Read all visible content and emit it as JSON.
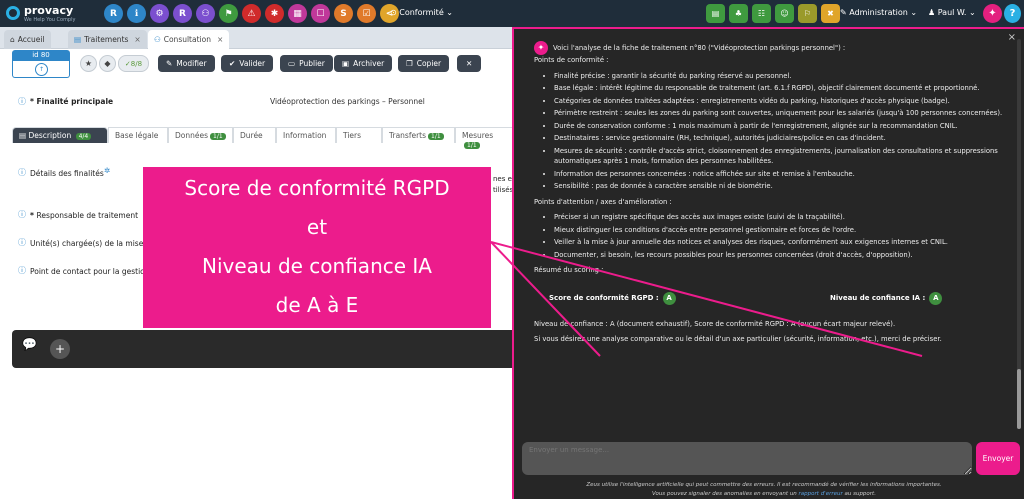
{
  "app": {
    "logo_name": "provacy",
    "logo_tagline": "We Help You Comply",
    "conformite_menu": "Conformité",
    "admin_menu": "Administration",
    "user_menu": "Paul W.",
    "nav_icons": [
      {
        "icon": "R",
        "color": "#2e86c8"
      },
      {
        "icon": "ℹ",
        "color": "#2e86c8"
      },
      {
        "icon": "⚙",
        "color": "#7b4fcf"
      },
      {
        "icon": "R",
        "color": "#7b4fcf"
      },
      {
        "icon": "⚇",
        "color": "#7b4fcf"
      },
      {
        "icon": "⚑",
        "color": "#3f9a3f"
      },
      {
        "icon": "⚠",
        "color": "#d02b2b"
      },
      {
        "icon": "✱",
        "color": "#d02b2b"
      },
      {
        "icon": "▦",
        "color": "#c0389a"
      },
      {
        "icon": "☐",
        "color": "#c0389a"
      },
      {
        "icon": "S",
        "color": "#e07a2a"
      },
      {
        "icon": "☑",
        "color": "#e07a2a"
      },
      {
        "icon": "<",
        "color": "#e0a52a"
      }
    ],
    "right_icons": [
      {
        "icon": "▤",
        "color": "#3f9a3f"
      },
      {
        "icon": "♣",
        "color": "#3f9a3f"
      },
      {
        "icon": "☷",
        "color": "#3f9a3f"
      },
      {
        "icon": "☺",
        "color": "#3f9a3f"
      },
      {
        "icon": "⚐",
        "color": "#9a9a2a"
      },
      {
        "icon": "✖",
        "color": "#e0a52a"
      }
    ]
  },
  "tabs": [
    {
      "label": "Accueil",
      "icon": "home-icon"
    },
    {
      "label": "Traitements",
      "icon": "list-icon"
    },
    {
      "label": "Consultation",
      "icon": "sitemap-icon"
    }
  ],
  "toolbar": {
    "id_label": "id 80",
    "check_count": "8/8",
    "buttons": [
      "Modifier",
      "Valider",
      "Publier",
      "Archiver",
      "Copier"
    ]
  },
  "form": {
    "finalite_label": "Finalité principale",
    "finalite_value": "Vidéoprotection des parkings – Personnel",
    "subtabs": [
      {
        "label": "Description",
        "badge": "4/4"
      },
      {
        "label": "Base légale",
        "badge": ""
      },
      {
        "label": "Données",
        "badge": "1/1"
      },
      {
        "label": "Durée",
        "badge": ""
      },
      {
        "label": "Information",
        "badge": ""
      },
      {
        "label": "Tiers",
        "badge": ""
      },
      {
        "label": "Transferts",
        "badge": "1/1"
      },
      {
        "label": "Mesures",
        "badge": "1/1"
      }
    ],
    "details_label": "Détails des finalités",
    "responsable_label": "Responsable de traitement",
    "unite_label": "Unité(s) chargée(s) de la mise e",
    "contact_label": "Point de contact pour la gestio",
    "details_partial_1": "nes et",
    "details_partial_2": "tilisés"
  },
  "callout": {
    "line1": "Score de conformité RGPD",
    "line2": "et",
    "line3": "Niveau de confiance IA",
    "line4": "de A à E"
  },
  "ai": {
    "intro": "Voici l'analyse de la fiche de traitement n°80 (\"Vidéoprotection parkings personnel\") :",
    "points_title": "Points de conformité :",
    "points": [
      "Finalité précise : garantir la sécurité du parking réservé au personnel.",
      "Base légale : intérêt légitime du responsable de traitement (art. 6.1.f RGPD), objectif clairement documenté et proportionné.",
      "Catégories de données traitées adaptées : enregistrements vidéo du parking, historiques d'accès physique (badge).",
      "Périmètre restreint : seules les zones du parking sont couvertes, uniquement pour les salariés (jusqu'à 100 personnes concernées).",
      "Durée de conservation conforme : 1 mois maximum à partir de l'enregistrement, alignée sur la recommandation CNIL.",
      "Destinataires : service gestionnaire (RH, technique), autorités judiciaires/police en cas d'incident.",
      "Mesures de sécurité : contrôle d'accès strict, cloisonnement des enregistrements, journalisation des consultations et suppressions automatiques après 1 mois, formation des personnes habilitées.",
      "Information des personnes concernées : notice affichée sur site et remise à l'embauche.",
      "Sensibilité : pas de donnée à caractère sensible ni de biométrie."
    ],
    "attention_title": "Points d'attention / axes d'amélioration :",
    "attention": [
      "Préciser si un registre spécifique des accès aux images existe (suivi de la traçabilité).",
      "Mieux distinguer les conditions d'accès entre personnel gestionnaire et forces de l'ordre.",
      "Veiller à la mise à jour annuelle des notices et analyses des risques, conformément aux exigences internes et CNIL.",
      "Documenter, si besoin, les recours possibles pour les personnes concernées (droit d'accès, d'opposition)."
    ],
    "scoring_title": "Résumé du scoring :",
    "score_label": "Score de conformité RGPD :",
    "score_value": "A",
    "confidence_label": "Niveau de confiance IA :",
    "confidence_value": "A",
    "summary": "Niveau de confiance : A (document exhaustif), Score de conformité RGPD : A (aucun écart majeur relevé).",
    "closing": "Si vous désirez une analyse comparative ou le détail d'un axe particulier (sécurité, information, etc.), merci de préciser.",
    "input_placeholder": "Envoyer un message...",
    "send_label": "Envoyer",
    "disclaimer_1": "Zeus utilise l'intelligence artificielle qui peut commettre des erreurs. Il est recommandé de vérifier les informations importantes.",
    "disclaimer_2a": "Vous pouvez signaler des anomalies en envoyant un",
    "disclaimer_link": "rapport d'erreur",
    "disclaimer_2b": "au support."
  }
}
